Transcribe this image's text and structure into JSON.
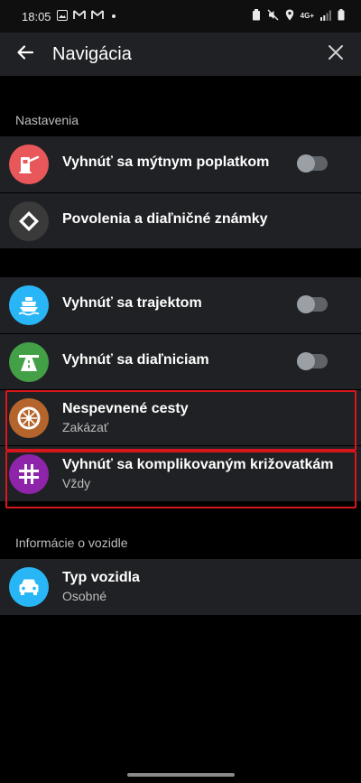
{
  "status_bar": {
    "time": "18:05",
    "network": "4G+"
  },
  "app_bar": {
    "title": "Navigácia"
  },
  "sections": {
    "settings_header": "Nastavenia",
    "vehicle_header": "Informácie o vozidle"
  },
  "rows": {
    "tolls": {
      "title": "Vyhnúť sa mýtnym poplatkom",
      "toggle_on": false
    },
    "permits": {
      "title": "Povolenia a diaľničné známky"
    },
    "ferries": {
      "title": "Vyhnúť sa trajektom",
      "toggle_on": false
    },
    "highways": {
      "title": "Vyhnúť sa diaľniciam",
      "toggle_on": false
    },
    "unpaved": {
      "title": "Nespevnené cesty",
      "value": "Zakázať"
    },
    "junctions": {
      "title": "Vyhnúť sa komplikovaným križovatkám",
      "value": "Vždy"
    },
    "vehicle": {
      "title": "Typ vozidla",
      "value": "Osobné"
    }
  },
  "icon_colors": {
    "tolls": "#e8575a",
    "permits": "#3a3a3a",
    "ferries": "#29b6f6",
    "highways": "#43a047",
    "unpaved": "#b5652b",
    "junctions": "#8e24aa",
    "vehicle": "#29b6f6"
  },
  "highlight_color": "#d6181c"
}
